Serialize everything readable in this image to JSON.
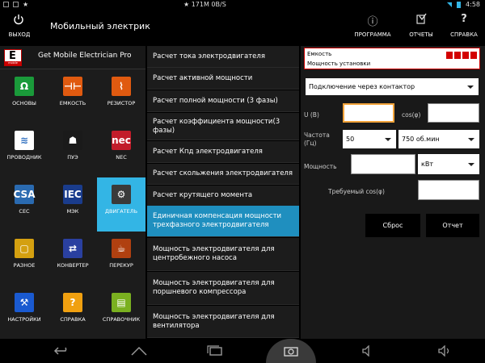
{
  "status": {
    "left_icons": [
      "usb-icon",
      "image-icon",
      "star-icon"
    ],
    "network_speed": "★ 171M  0B/S",
    "time": "4:58"
  },
  "actionbar": {
    "exit_label": "ВЫХОД",
    "title": "Мобильный электрик",
    "program_label": "ПРОГРАММА",
    "reports_label": "ОТЧЕТЫ",
    "help_label": "СПРАВКА",
    "help_icon": "?",
    "info_icon": "ⓘ"
  },
  "left": {
    "brand_logo_letter": "E",
    "brand_logo_text": "mobile",
    "brand": "Get Mobile Electrician Pro",
    "tiles": [
      {
        "label": "ОСНОВЫ",
        "glyph": "Ω",
        "color": "#1a9a3a"
      },
      {
        "label": "ЕМКОСТЬ",
        "glyph": "⊣⊢",
        "color": "#e05a10"
      },
      {
        "label": "РЕЗИСТОР",
        "glyph": "⌇",
        "color": "#e05a10"
      },
      {
        "label": "ПРОВОДНИК",
        "glyph": "≋",
        "color": "#ffffff"
      },
      {
        "label": "ПУЭ",
        "glyph": "☗",
        "color": "#1a1a1a"
      },
      {
        "label": "NEC",
        "glyph": "nec",
        "color": "#c21c2a"
      },
      {
        "label": "CEC",
        "glyph": "CSA",
        "color": "#2a6ab0"
      },
      {
        "label": "МЭК",
        "glyph": "IEC",
        "color": "#1a3c8c"
      },
      {
        "label": "ДВИГАТЕЛЬ",
        "glyph": "⚙",
        "color": "#3a3a3a"
      },
      {
        "label": "РАЗНОЕ",
        "glyph": "▢",
        "color": "#d4a010"
      },
      {
        "label": "КОНВЕРТЕР",
        "glyph": "⇄",
        "color": "#2a40a0"
      },
      {
        "label": "ПЕРЕКУР",
        "glyph": "☕",
        "color": "#b04010"
      },
      {
        "label": "НАСТРОЙКИ",
        "glyph": "⚒",
        "color": "#1a5ad0"
      },
      {
        "label": "СПРАВКА",
        "glyph": "?",
        "color": "#f0a010"
      },
      {
        "label": "СПРАВОЧНИК",
        "glyph": "▤",
        "color": "#7ab020"
      }
    ]
  },
  "menu": {
    "items": [
      "Расчет тока электродвигателя",
      "Расчет активной мощности",
      "Расчет полной мощности (3 фазы)",
      "Расчет коэффициента мощности(3 фазы)",
      "Расчет Кпд электродвигателя",
      "Расчет скольжения электродвигателя",
      "Расчет крутящего момента",
      "Единичная компенсация мощности трехфазного электродвигателя",
      "Мощность электродвигателя для центробежного насоса",
      "Мощность электродвигателя для поршневого компрессора",
      "Мощность электродвигателя для вентилятора"
    ]
  },
  "form": {
    "notice_line1": "Емкость",
    "notice_line2": "Мощность установки",
    "connection_select": "Подключение через контактор",
    "u_label": "U (В)",
    "u_value": "",
    "cos_label": "cos(φ)",
    "cos_value": "",
    "freq_label": "Частота (Гц)",
    "freq_select": "50",
    "rpm_select": "750 об.мин",
    "power_label": "Мощность",
    "power_value": "",
    "power_unit": "кВт",
    "req_cos_label": "Требуемый cos(φ)",
    "req_cos_value": "",
    "reset_button": "Сброс",
    "report_button": "Отчет"
  }
}
